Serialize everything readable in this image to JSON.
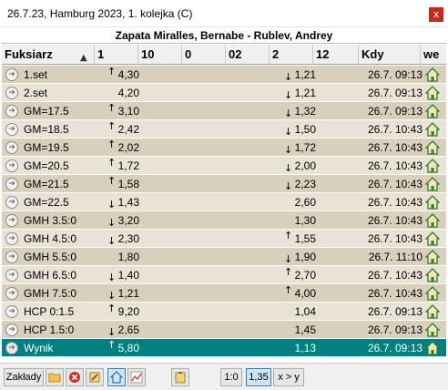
{
  "window": {
    "title": "26.7.23, Hamburg 2023, 1. kolejka (C)",
    "close_glyph": "x"
  },
  "match": {
    "title": "Zapata Miralles, Bernabe - Rublev, Andrey"
  },
  "columns": {
    "name": "Fuksiarz",
    "sort_indicator": "▲",
    "c1": "1",
    "c10": "10",
    "c0": "0",
    "c02": "02",
    "c2": "2",
    "c12": "12",
    "kdy": "Kdy",
    "we": "we"
  },
  "rows": [
    {
      "name": "1.set",
      "odd1": "4,30",
      "arr1": "up",
      "odd2": "1,21",
      "arr2": "down",
      "time": "26.7. 09:13"
    },
    {
      "name": "2.set",
      "odd1": "4,20",
      "arr1": "",
      "odd2": "1,21",
      "arr2": "down",
      "time": "26.7. 09:13"
    },
    {
      "name": "GM=17.5",
      "odd1": "3,10",
      "arr1": "up",
      "odd2": "1,32",
      "arr2": "down",
      "time": "26.7. 09:13"
    },
    {
      "name": "GM=18.5",
      "odd1": "2,42",
      "arr1": "up",
      "odd2": "1,50",
      "arr2": "down",
      "time": "26.7. 10:43"
    },
    {
      "name": "GM=19.5",
      "odd1": "2,02",
      "arr1": "up",
      "odd2": "1,72",
      "arr2": "down",
      "time": "26.7. 10:43"
    },
    {
      "name": "GM=20.5",
      "odd1": "1,72",
      "arr1": "up",
      "odd2": "2,00",
      "arr2": "down",
      "time": "26.7. 10:43"
    },
    {
      "name": "GM=21.5",
      "odd1": "1,58",
      "arr1": "up",
      "odd2": "2,23",
      "arr2": "down",
      "time": "26.7. 10:43"
    },
    {
      "name": "GM=22.5",
      "odd1": "1,43",
      "arr1": "down",
      "odd2": "2,60",
      "arr2": "",
      "time": "26.7. 10:43"
    },
    {
      "name": "GMH 3.5:0",
      "odd1": "3,20",
      "arr1": "down",
      "odd2": "1,30",
      "arr2": "",
      "time": "26.7. 10:43"
    },
    {
      "name": "GMH 4.5:0",
      "odd1": "2,30",
      "arr1": "down",
      "odd2": "1,55",
      "arr2": "up",
      "time": "26.7. 10:43"
    },
    {
      "name": "GMH 5.5:0",
      "odd1": "1,80",
      "arr1": "",
      "odd2": "1,90",
      "arr2": "down",
      "time": "26.7. 11:10"
    },
    {
      "name": "GMH 6.5:0",
      "odd1": "1,40",
      "arr1": "down",
      "odd2": "2,70",
      "arr2": "up",
      "time": "26.7. 10:43"
    },
    {
      "name": "GMH 7.5:0",
      "odd1": "1,21",
      "arr1": "down",
      "odd2": "4,00",
      "arr2": "up",
      "time": "26.7. 10:43"
    },
    {
      "name": "HCP 0:1.5",
      "odd1": "9,20",
      "arr1": "up",
      "odd2": "1,04",
      "arr2": "",
      "time": "26.7. 09:13"
    },
    {
      "name": "HCP 1.5:0",
      "odd1": "2,65",
      "arr1": "down",
      "odd2": "1,45",
      "arr2": "",
      "time": "26.7. 09:13"
    },
    {
      "name": "Wynik",
      "odd1": "5,80",
      "arr1": "up",
      "odd2": "1,13",
      "arr2": "",
      "time": "26.7. 09:13",
      "selected": true
    }
  ],
  "toolbar": {
    "zaklady": "Zakłady",
    "ratio_10": "1:0",
    "odds_value": "1,35",
    "xy": "x > y"
  },
  "colors": {
    "row_odd": "#d9cfbd",
    "row_even": "#e9e3d7",
    "selected": "#008080",
    "close": "#c42b1c",
    "home_icon": "#2e7d32"
  }
}
